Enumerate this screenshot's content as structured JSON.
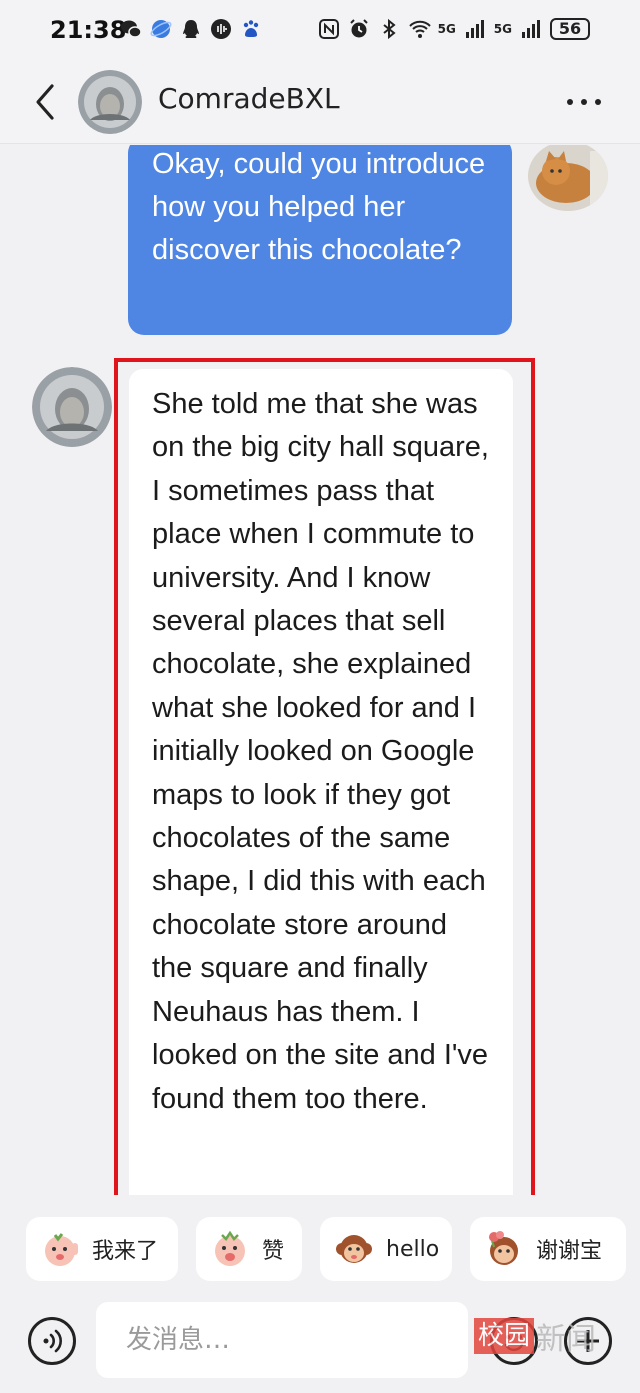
{
  "status_bar": {
    "time": "21:38",
    "network_label_1": "5G",
    "network_label_2": "5G",
    "battery": "56"
  },
  "header": {
    "contact_name": "ComradeBXL"
  },
  "messages": {
    "outgoing_text": "Okay, could you introduce how you helped her discover this chocolate?",
    "incoming_text": "She told me that she was on the big city hall square, I sometimes pass that place when I commute to university. And I know several places that sell chocolate, she explained what she looked for and I initially looked on Google maps to look if they got chocolates of the same shape, I did this with each chocolate store around the square and finally Neuhaus has them. I looked on the site and I've found them too there."
  },
  "quick_replies": [
    {
      "label": "我来了",
      "icon": "waving-sticker-icon"
    },
    {
      "label": "赞",
      "icon": "thumbs-up-sticker-icon"
    },
    {
      "label": "hello",
      "icon": "monkey-sticker-icon"
    },
    {
      "label": "谢谢宝",
      "icon": "thanks-sticker-icon"
    }
  ],
  "input": {
    "placeholder": "发消息…"
  },
  "watermark": {
    "box": "校园",
    "text": "新闻"
  },
  "colors": {
    "outgoing_bubble": "#4f86e4",
    "highlight_border": "#e0141b",
    "background": "#f1f1f3"
  }
}
